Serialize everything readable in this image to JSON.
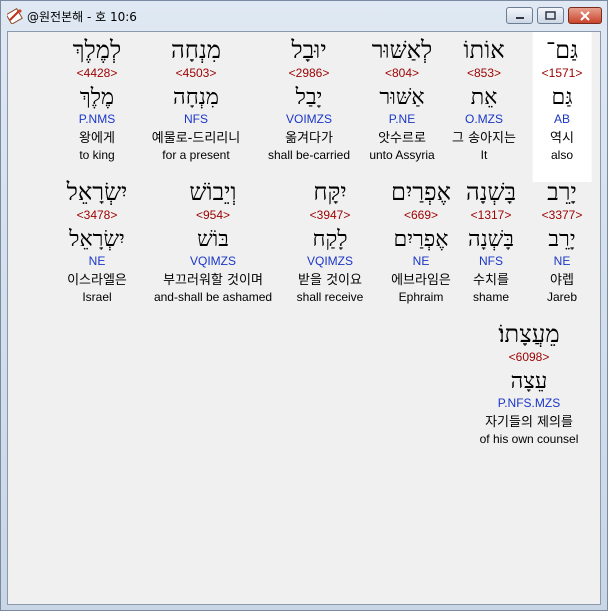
{
  "window": {
    "title": "@원전본해 - 호 10:6"
  },
  "rows": [
    [
      {
        "hebrew": "גַּם־",
        "strongs": "<1571>",
        "lexeme": "גַּם",
        "parsing": "AB",
        "korean": "역시",
        "english": "also",
        "selected": true
      },
      {
        "hebrew": "אוֹתוֹ",
        "strongs": "<853>",
        "lexeme": "אֵת",
        "parsing": "O.MZS",
        "korean": "그 송아지는",
        "english": "It"
      },
      {
        "hebrew": "לְאַשּׁוּר",
        "strongs": "<804>",
        "lexeme": "אַשּׁוּר",
        "parsing": "P.NE",
        "korean": "앗수르로",
        "english": "unto Assyria"
      },
      {
        "hebrew": "יוּבָל",
        "strongs": "<2986>",
        "lexeme": "יָבַל",
        "parsing": "VOIMZS",
        "korean": "옮겨다가",
        "english": "shall be-carried"
      },
      {
        "hebrew": "מִנְחָה",
        "strongs": "<4503>",
        "lexeme": "מִנְחָה",
        "parsing": "NFS",
        "korean": "예물로-드리리니",
        "english": "for a present"
      },
      {
        "hebrew": "לְמֶלֶךְ",
        "strongs": "<4428>",
        "lexeme": "מֶלֶךְ",
        "parsing": "P.NMS",
        "korean": "왕에게",
        "english": "to king"
      }
    ],
    [
      {
        "hebrew": "יָרֵב",
        "strongs": "<3377>",
        "lexeme": "יָרֵב",
        "parsing": "NE",
        "korean": "야렙",
        "english": "Jareb"
      },
      {
        "hebrew": "בָּשְׁנָה",
        "strongs": "<1317>",
        "lexeme": "בָּשְׁנָה",
        "parsing": "NFS",
        "korean": "수치를",
        "english": "shame"
      },
      {
        "hebrew": "אֶפְרַיִם",
        "strongs": "<669>",
        "lexeme": "אֶפְרַיִם",
        "parsing": "NE",
        "korean": "에브라임은",
        "english": "Ephraim"
      },
      {
        "hebrew": "יִקָּח",
        "strongs": "<3947>",
        "lexeme": "לָקַח",
        "parsing": "VQIMZS",
        "korean": "받을 것이요",
        "english": "shall receive"
      },
      {
        "hebrew": "וְיֵבוֹשׁ",
        "strongs": "<954>",
        "lexeme": "בּוֹשׁ",
        "parsing": "VQIMZS",
        "korean": "부끄러워할 것이며",
        "english": "and-shall be ashamed"
      },
      {
        "hebrew": "יִשְׂרָאֵל",
        "strongs": "<3478>",
        "lexeme": "יִשְׂרָאֵל",
        "parsing": "NE",
        "korean": "이스라엘은",
        "english": "Israel"
      }
    ],
    [
      {
        "hebrew": "מֵעֲצָתוֹ׃",
        "strongs": "<6098>",
        "lexeme": "עֵצָה",
        "parsing": "P.NFS.MZS",
        "korean": "자기들의 제의를",
        "english": "of his own counsel"
      }
    ]
  ]
}
